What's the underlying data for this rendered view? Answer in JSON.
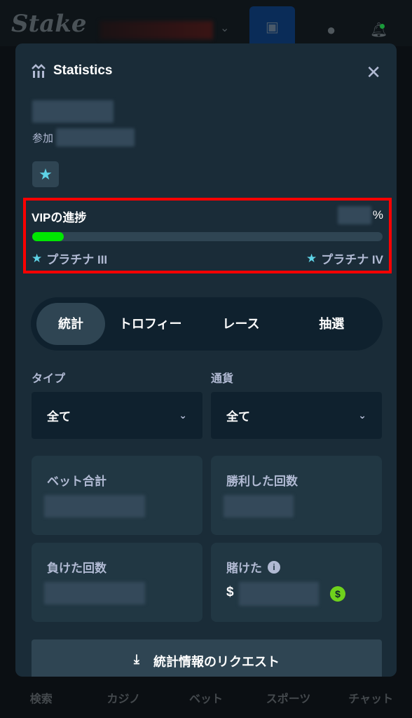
{
  "header": {
    "logo": "Stake"
  },
  "bottom_nav": [
    "検索",
    "カジノ",
    "ベット",
    "スポーツ",
    "チャット"
  ],
  "modal": {
    "title": "Statistics",
    "joined_label": "参加",
    "vip": {
      "title": "VIPの進捗",
      "percent_sign": "%",
      "progress_fraction": 0.09,
      "current_level": "プラチナ III",
      "next_level": "プラチナ IV",
      "fill_color": "#00e701"
    },
    "tabs": [
      "統計",
      "トロフィー",
      "レース",
      "抽選"
    ],
    "active_tab": "統計",
    "filters": {
      "type_label": "タイプ",
      "type_value": "全て",
      "currency_label": "通貨",
      "currency_value": "全て"
    },
    "cards": {
      "total_bets": "ベット合計",
      "wins": "勝利した回数",
      "losses": "負けた回数",
      "wagered": "賭けた",
      "currency_symbol": "$"
    },
    "request_button": "統計情報のリクエスト"
  }
}
